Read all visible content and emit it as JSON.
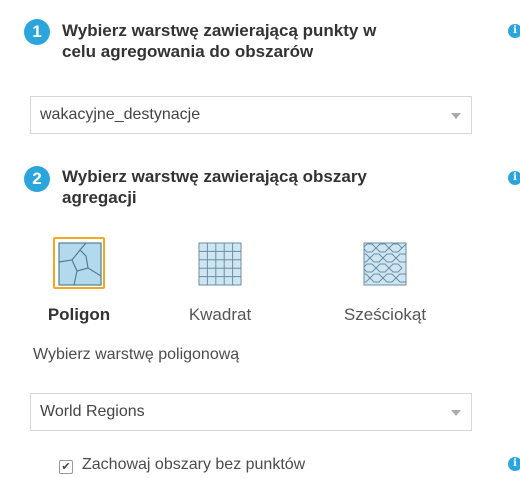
{
  "step1": {
    "number": "1",
    "title_line1": "Wybierz warstwę zawierającą punkty w",
    "title_line2": "celu agregowania do obszarów",
    "select_value": "wakacyjne_destynacje"
  },
  "step2": {
    "number": "2",
    "title_line1": "Wybierz warstwę zawierającą obszary",
    "title_line2": "agregacji",
    "shapes": [
      {
        "label": "Poligon",
        "icon": "polygon-icon",
        "selected": true
      },
      {
        "label": "Kwadrat",
        "icon": "square-grid-icon",
        "selected": false
      },
      {
        "label": "Sześciokąt",
        "icon": "hexagon-grid-icon",
        "selected": false
      }
    ],
    "layer_prompt": "Wybierz warstwę poligonową",
    "select_value": "World Regions",
    "checkbox_label": "Zachowaj obszary bez punktów",
    "checkbox_checked": true
  },
  "icons": {
    "info": "info-icon",
    "check": "✔"
  },
  "colors": {
    "accent": "#2ba5dc",
    "selected_border": "#f5a623",
    "polygon_fill": "#b3d9ec",
    "grid_fill": "#cfe6f2"
  }
}
